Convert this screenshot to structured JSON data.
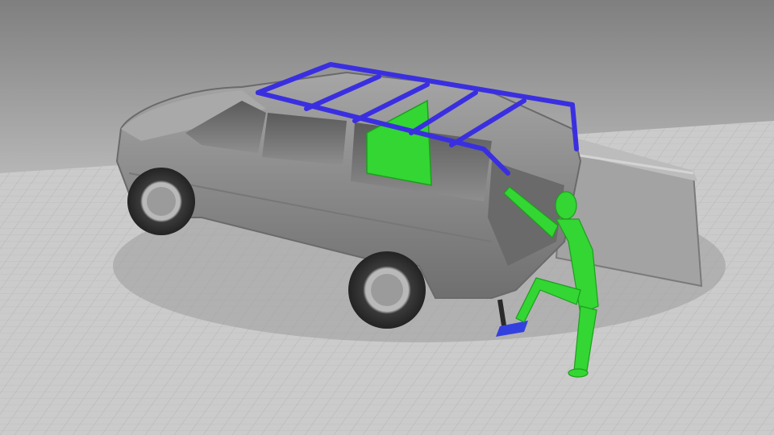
{
  "scene": {
    "subject": "suv-with-roof-rack-and-human-figure",
    "colors": {
      "vehicle": "#8c8c8c",
      "vehicle_dark": "#5e5e5e",
      "rack": "#3a2fe0",
      "figure": "#2fd42f",
      "step": "#3340e0",
      "tire": "#2b2b2b",
      "floor": "#c9c9c9",
      "grid": "#b4b4b4",
      "backdrop_top": "#8a8a8a",
      "backdrop_bottom": "#d6d6d6"
    }
  }
}
